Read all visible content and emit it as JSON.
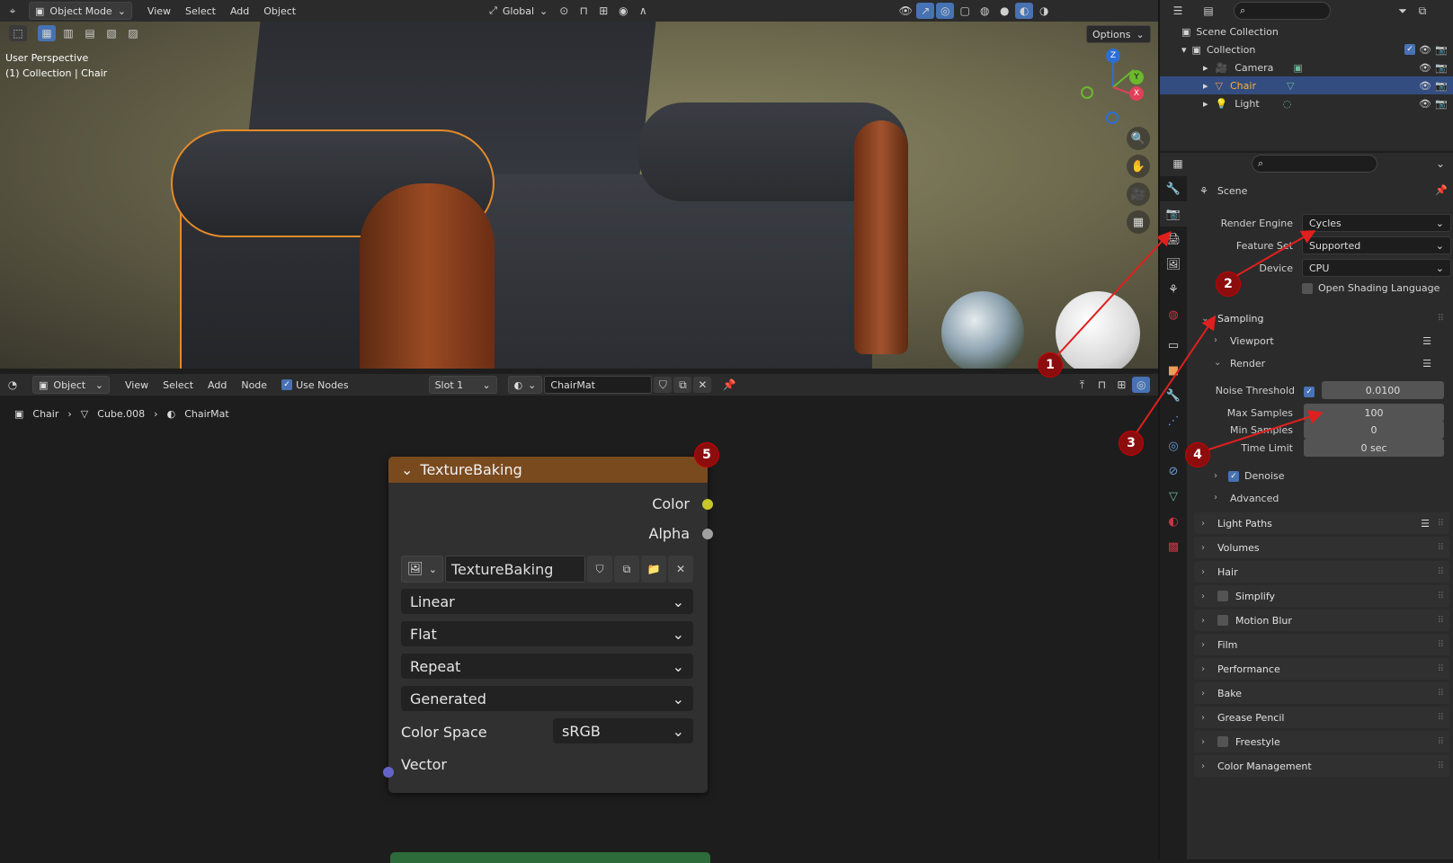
{
  "viewport": {
    "header": {
      "mode": "Object Mode",
      "menus": [
        "View",
        "Select",
        "Add",
        "Object"
      ],
      "transform_orientation": "Global",
      "options_label": "Options"
    },
    "overlay_text": {
      "perspective": "User Perspective",
      "context": "(1) Collection | Chair"
    },
    "gizmo": {
      "z": "Z",
      "y": "Y",
      "x": "X"
    }
  },
  "node_editor": {
    "header": {
      "mode": "Object",
      "menus": [
        "View",
        "Select",
        "Add",
        "Node"
      ],
      "use_nodes_label": "Use Nodes",
      "slot": "Slot 1",
      "material": "ChairMat"
    },
    "breadcrumb": [
      "Chair",
      "Cube.008",
      "ChairMat"
    ],
    "node": {
      "title": "TextureBaking",
      "outputs": [
        "Color",
        "Alpha"
      ],
      "image_name": "TextureBaking",
      "interpolation": "Linear",
      "projection": "Flat",
      "extension": "Repeat",
      "source": "Generated",
      "color_space_label": "Color Space",
      "color_space": "sRGB",
      "input": "Vector"
    }
  },
  "outliner": {
    "root": "Scene Collection",
    "collection": "Collection",
    "items": [
      "Camera",
      "Chair",
      "Light"
    ]
  },
  "properties": {
    "context": "Scene",
    "render_engine_label": "Render Engine",
    "render_engine": "Cycles",
    "feature_set_label": "Feature Set",
    "feature_set": "Supported",
    "device_label": "Device",
    "device": "CPU",
    "osl_label": "Open Shading Language",
    "sampling": {
      "label": "Sampling",
      "viewport": "Viewport",
      "render": "Render",
      "noise_threshold_label": "Noise Threshold",
      "noise_threshold": "0.0100",
      "max_samples_label": "Max Samples",
      "max_samples": "100",
      "min_samples_label": "Min Samples",
      "min_samples": "0",
      "time_limit_label": "Time Limit",
      "time_limit": "0 sec",
      "denoise": "Denoise",
      "advanced": "Advanced"
    },
    "sections": [
      "Light Paths",
      "Volumes",
      "Hair",
      "Simplify",
      "Motion Blur",
      "Film",
      "Performance",
      "Bake",
      "Grease Pencil",
      "Freestyle",
      "Color Management"
    ]
  },
  "annotations": [
    "1",
    "2",
    "3",
    "4",
    "5"
  ],
  "colors": {
    "selection": "#4772b3",
    "node_header": "#7a4a1f",
    "annotation": "#8b0d0d",
    "arrow": "#e0201e",
    "outline": "#e58a28"
  }
}
